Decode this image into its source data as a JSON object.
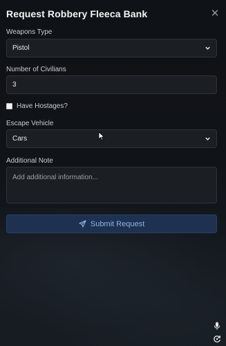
{
  "header": {
    "title": "Request Robbery Fleeca Bank",
    "close_symbol": "✕"
  },
  "weapons": {
    "label": "Weapons Type",
    "selected": "Pistol"
  },
  "civilians": {
    "label": "Number of Civilians",
    "value": "3"
  },
  "hostages": {
    "label": "Have Hostages?",
    "checked": false
  },
  "vehicle": {
    "label": "Escape Vehicle",
    "selected": "Cars"
  },
  "note": {
    "label": "Additional Note",
    "placeholder": "Add additional information..."
  },
  "submit": {
    "label": "Submit Request"
  },
  "icons": {
    "close": "close-icon",
    "chevron": "chevron-down-icon",
    "send": "send-icon",
    "cursor": "mouse-cursor-icon",
    "mic": "microphone-icon",
    "rotate": "rotate-icon"
  },
  "colors": {
    "panel_bg": "#101317",
    "field_bg": "#1b1f24",
    "submit_bg": "#1e3150",
    "submit_text": "#8fb3e6"
  }
}
